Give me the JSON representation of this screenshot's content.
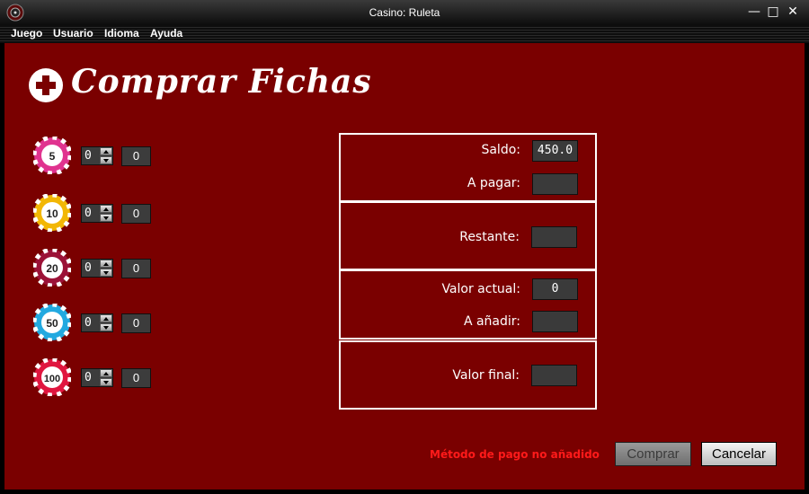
{
  "window": {
    "title": "Casino: Ruleta",
    "minimize": "—",
    "maximize": "□",
    "close": "✕"
  },
  "menu": [
    {
      "label": "Juego",
      "mnemonic": "Juego"
    },
    {
      "label": "Usuario",
      "mnemonic": "Usuario"
    },
    {
      "label": "Idioma",
      "mnemonic": "Idioma"
    },
    {
      "label": "Ayuda",
      "mnemonic": "Ayuda"
    }
  ],
  "header": {
    "title": "Comprar Fichas",
    "icon": "plus-circle-icon"
  },
  "chips": [
    {
      "value": "5",
      "quantity": "0",
      "total": "0",
      "color": "#e0338f"
    },
    {
      "value": "10",
      "quantity": "0",
      "total": "0",
      "color": "#f2b705"
    },
    {
      "value": "20",
      "quantity": "0",
      "total": "0",
      "color": "#9b1237"
    },
    {
      "value": "50",
      "quantity": "0",
      "total": "0",
      "color": "#22a9e0"
    },
    {
      "value": "100",
      "quantity": "0",
      "total": "0",
      "color": "#e0163f"
    }
  ],
  "balance": {
    "saldo_label": "Saldo:",
    "saldo_value": "450.0",
    "a_pagar_label": "A pagar:",
    "a_pagar_value": "",
    "restante_label": "Restante:",
    "restante_value": "",
    "valor_actual_label": "Valor actual:",
    "valor_actual_value": "0",
    "a_anadir_label": "A añadir:",
    "a_anadir_value": "",
    "valor_final_label": "Valor final:",
    "valor_final_value": ""
  },
  "status": {
    "error": "Método de pago no añadido"
  },
  "buttons": {
    "buy": "Comprar",
    "cancel": "Cancelar"
  },
  "colors": {
    "background": "#7a0000",
    "error": "#ff1a1a"
  }
}
